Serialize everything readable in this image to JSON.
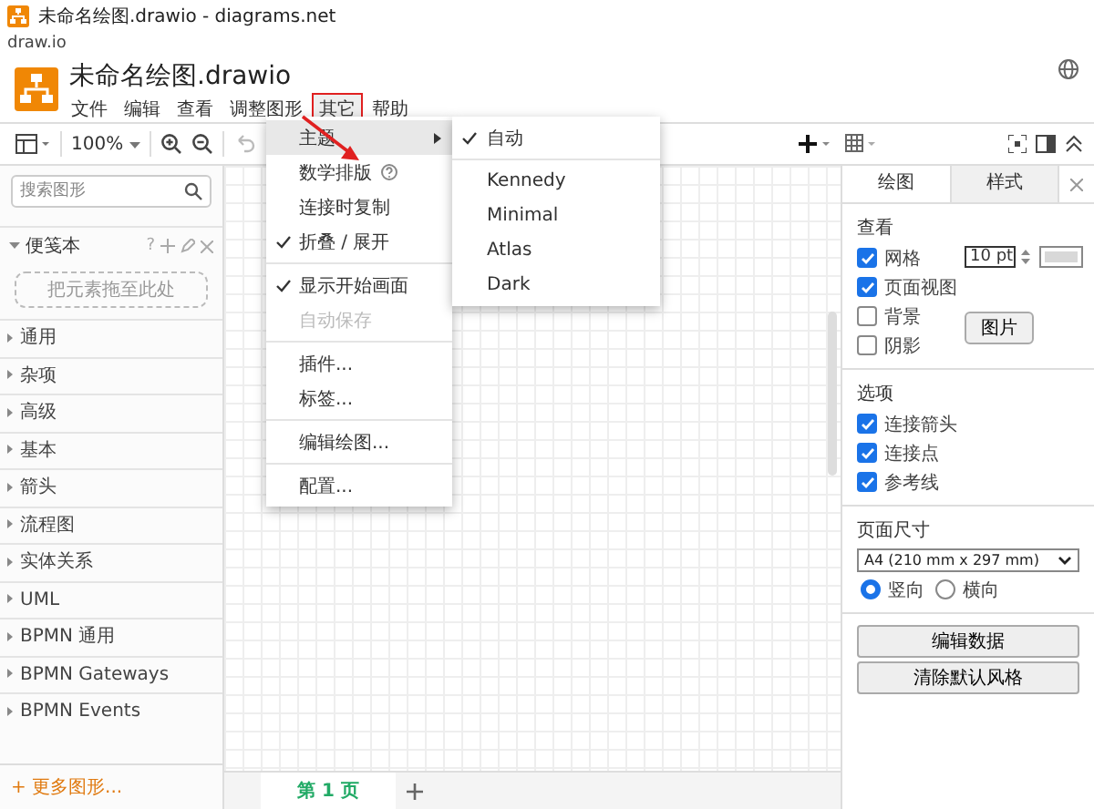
{
  "window": {
    "title": "未命名绘图.drawio - diagrams.net",
    "address": "draw.io"
  },
  "header": {
    "file_title": "未命名绘图.drawio"
  },
  "menubar": [
    {
      "label": "文件",
      "selected": false
    },
    {
      "label": "编辑",
      "selected": false
    },
    {
      "label": "查看",
      "selected": false
    },
    {
      "label": "调整图形",
      "selected": false
    },
    {
      "label": "其它",
      "selected": true
    },
    {
      "label": "帮助",
      "selected": false
    }
  ],
  "toolbar": {
    "zoom": "100%"
  },
  "sidebar": {
    "search": {
      "placeholder": "搜索图形"
    },
    "scratchpad": {
      "title": "便笺本",
      "help": "?",
      "dropzone": "把元素拖至此处"
    },
    "categories": [
      "通用",
      "杂项",
      "高级",
      "基本",
      "箭头",
      "流程图",
      "实体关系",
      "UML",
      "BPMN 通用",
      "BPMN Gateways",
      "BPMN Events"
    ],
    "more": "+ 更多图形..."
  },
  "menu": {
    "groups": [
      [
        {
          "label": "主题",
          "kind": "submenu",
          "checked": false,
          "disabled": false,
          "selected": true
        },
        {
          "label": "数学排版",
          "kind": "help",
          "checked": false,
          "disabled": false,
          "selected": false
        },
        {
          "label": "连接时复制",
          "kind": "plain",
          "checked": false,
          "disabled": false,
          "selected": false
        },
        {
          "label": "折叠 / 展开",
          "kind": "plain",
          "checked": true,
          "disabled": false,
          "selected": false
        }
      ],
      [
        {
          "label": "显示开始画面",
          "kind": "plain",
          "checked": true,
          "disabled": false,
          "selected": false
        },
        {
          "label": "自动保存",
          "kind": "plain",
          "checked": false,
          "disabled": true,
          "selected": false
        }
      ],
      [
        {
          "label": "插件...",
          "kind": "plain",
          "checked": false,
          "disabled": false,
          "selected": false
        },
        {
          "label": "标签...",
          "kind": "plain",
          "checked": false,
          "disabled": false,
          "selected": false
        }
      ],
      [
        {
          "label": "编辑绘图...",
          "kind": "plain",
          "checked": false,
          "disabled": false,
          "selected": false
        }
      ],
      [
        {
          "label": "配置...",
          "kind": "plain",
          "checked": false,
          "disabled": false,
          "selected": false
        }
      ]
    ]
  },
  "submenu": [
    {
      "label": "自动",
      "checked": true
    },
    {
      "label": "Kennedy",
      "checked": false
    },
    {
      "label": "Minimal",
      "checked": false
    },
    {
      "label": "Atlas",
      "checked": false
    },
    {
      "label": "Dark",
      "checked": false
    }
  ],
  "panel": {
    "tabs": [
      {
        "label": "绘图",
        "selected": true
      },
      {
        "label": "样式",
        "selected": false
      }
    ],
    "view_title": "查看",
    "view_options": [
      {
        "label": "网格",
        "checked": true
      },
      {
        "label": "页面视图",
        "checked": true
      },
      {
        "label": "背景",
        "checked": false
      },
      {
        "label": "阴影",
        "checked": false
      }
    ],
    "grid_size": "10 pt",
    "image_button": "图片",
    "options_title": "选项",
    "options": [
      {
        "label": "连接箭头",
        "checked": true
      },
      {
        "label": "连接点",
        "checked": true
      },
      {
        "label": "参考线",
        "checked": true
      }
    ],
    "page_size_title": "页面尺寸",
    "page_size": "A4 (210 mm x 297 mm)",
    "orientation": [
      {
        "label": "竖向",
        "selected": true
      },
      {
        "label": "横向",
        "selected": false
      }
    ],
    "buttons": [
      "编辑数据",
      "清除默认风格"
    ]
  },
  "pages": [
    {
      "label": "第 1 页",
      "selected": true
    }
  ]
}
